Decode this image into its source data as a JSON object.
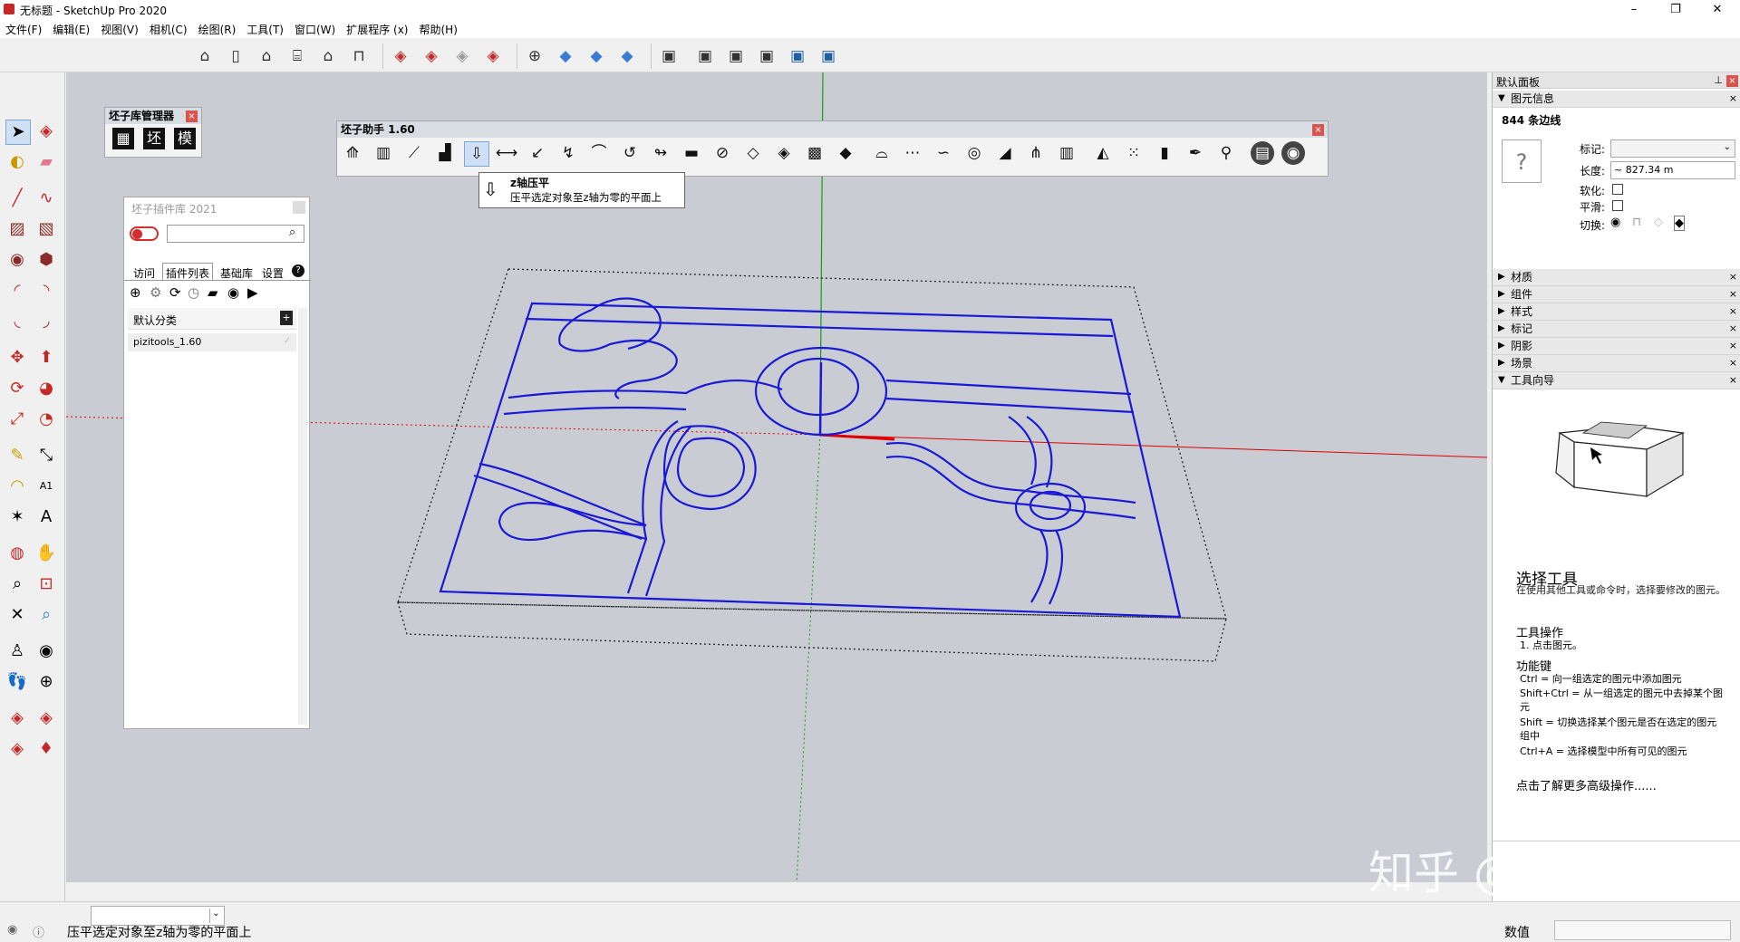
{
  "app": {
    "title": "无标题 - SketchUp Pro 2020"
  },
  "window_buttons": {
    "minimize": "–",
    "restore": "❐",
    "close": "✕"
  },
  "menu": [
    "文件(F)",
    "编辑(E)",
    "视图(V)",
    "相机(C)",
    "绘图(R)",
    "工具(T)",
    "窗口(W)",
    "扩展程序 (x)",
    "帮助(H)"
  ],
  "pizi_manager": {
    "title": "坯子库管理器",
    "buttons": [
      "坯",
      "模"
    ]
  },
  "plugin_lib": {
    "title": "坯子插件库 2021",
    "tabs": [
      "访问",
      "插件列表",
      "基础库",
      "设置"
    ],
    "help": "?",
    "category_label": "默认分类",
    "plugin_item": "pizitools_1.60"
  },
  "pizi_helper": {
    "title": "坯子助手 1.60",
    "tooltip_title": "z轴压平",
    "tooltip_desc": "压平选定对象至z轴为零的平面上"
  },
  "right_panel": {
    "title": "默认面板",
    "entity_info": {
      "section": "图元信息",
      "heading": "844 条边线",
      "help_mark": "?",
      "tag_label": "标记:",
      "length_label": "长度:",
      "length_value": "~ 827.34 m",
      "soften_label": "软化:",
      "smooth_label": "平滑:",
      "toggle_label": "切换:"
    },
    "sections": [
      "材质",
      "组件",
      "样式",
      "标记",
      "阴影",
      "场景",
      "工具向导"
    ],
    "instructor": {
      "tool_name": "选择工具",
      "tool_desc": "在使用其他工具或命令时，选择要修改的图元。",
      "ops_title": "工具操作",
      "ops_item": "1. 点击图元。",
      "keys_title": "功能键",
      "keys": [
        "Ctrl = 向一组选定的图元中添加图元",
        "Shift+Ctrl = 从一组选定的图元中去掉某个图元",
        "Shift = 切换选择某个图元是否在选定的图元组中",
        "Ctrl+A = 选择模型中所有可见的图元"
      ],
      "more_link": "点击了解更多高级操作......"
    }
  },
  "watermark": "知乎 @氧设计",
  "status": {
    "hint": "压平选定对象至z轴为零的平面上",
    "measure_label": "数值"
  },
  "colors": {
    "model_edges": "#1a1ad6",
    "viewport_bg": "#c9ccd3",
    "axis_red": "#e00000",
    "axis_green": "#10a010"
  }
}
